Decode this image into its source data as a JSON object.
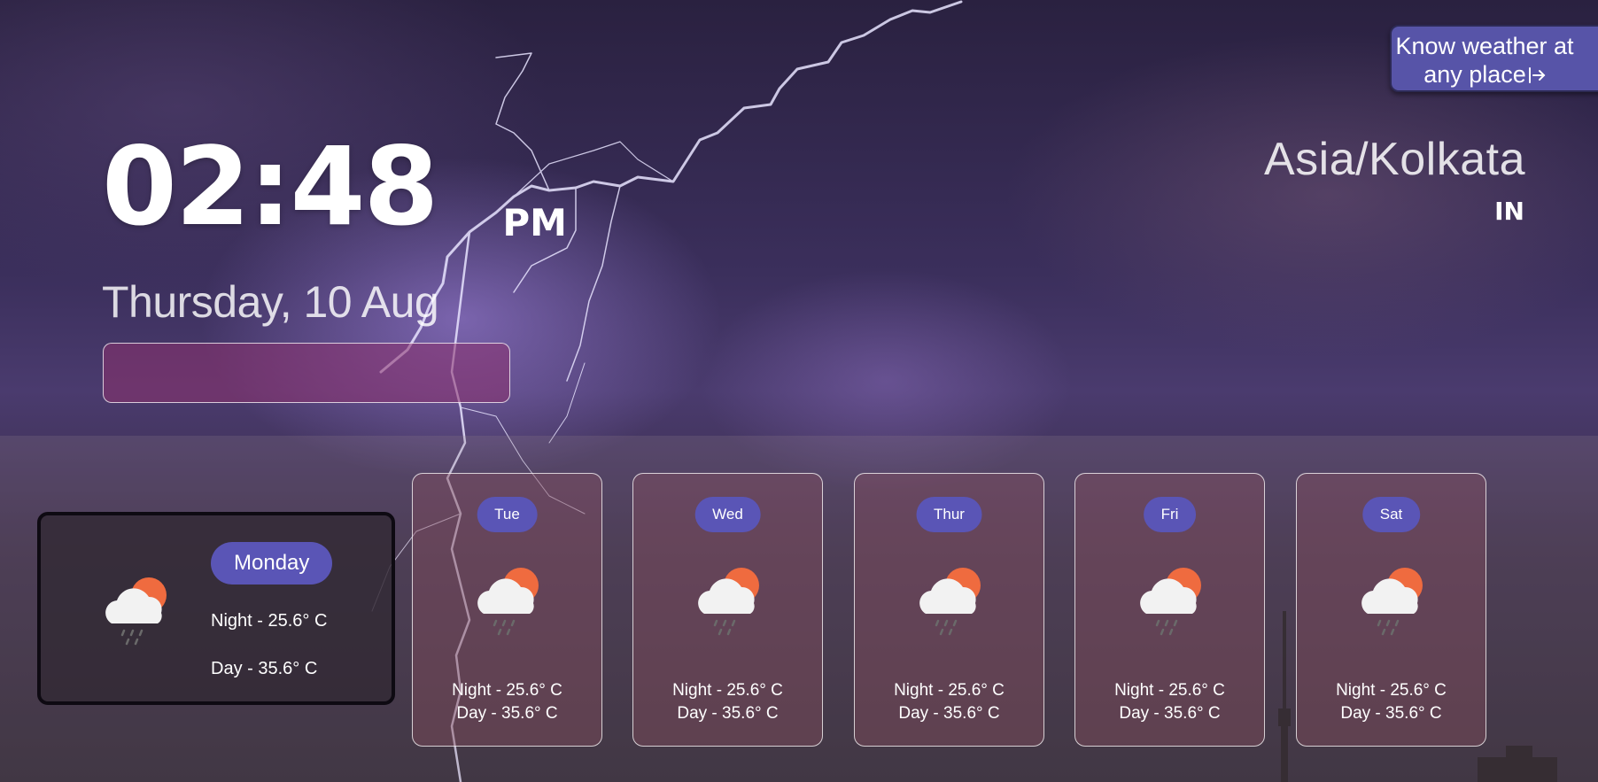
{
  "clock": {
    "time": "02:48",
    "ampm": "PM",
    "date": "Thursday, 10 Aug"
  },
  "location": {
    "timezone": "Asia/Kolkata",
    "country": "IN"
  },
  "cta": {
    "line1": "Know weather at",
    "line2": "any place",
    "icon": "arrow-right-bar-icon"
  },
  "today": {
    "day": "Monday",
    "night": "Night - 25.6° C",
    "day_temp": "Day - 35.6° C",
    "icon": "cloud-sun-rain-icon"
  },
  "forecast": [
    {
      "day": "Tue",
      "night": "Night - 25.6° C",
      "day_temp": "Day - 35.6° C",
      "icon": "cloud-sun-rain-icon"
    },
    {
      "day": "Wed",
      "night": "Night - 25.6° C",
      "day_temp": "Day - 35.6° C",
      "icon": "cloud-sun-rain-icon"
    },
    {
      "day": "Thur",
      "night": "Night - 25.6° C",
      "day_temp": "Day - 35.6° C",
      "icon": "cloud-sun-rain-icon"
    },
    {
      "day": "Fri",
      "night": "Night - 25.6° C",
      "day_temp": "Day - 35.6° C",
      "icon": "cloud-sun-rain-icon"
    },
    {
      "day": "Sat",
      "night": "Night - 25.6° C",
      "day_temp": "Day - 35.6° C",
      "icon": "cloud-sun-rain-icon"
    }
  ],
  "colors": {
    "accent_pill": "#5a55b6",
    "cta_button": "#5754a8",
    "info_box": "#8c326e"
  }
}
